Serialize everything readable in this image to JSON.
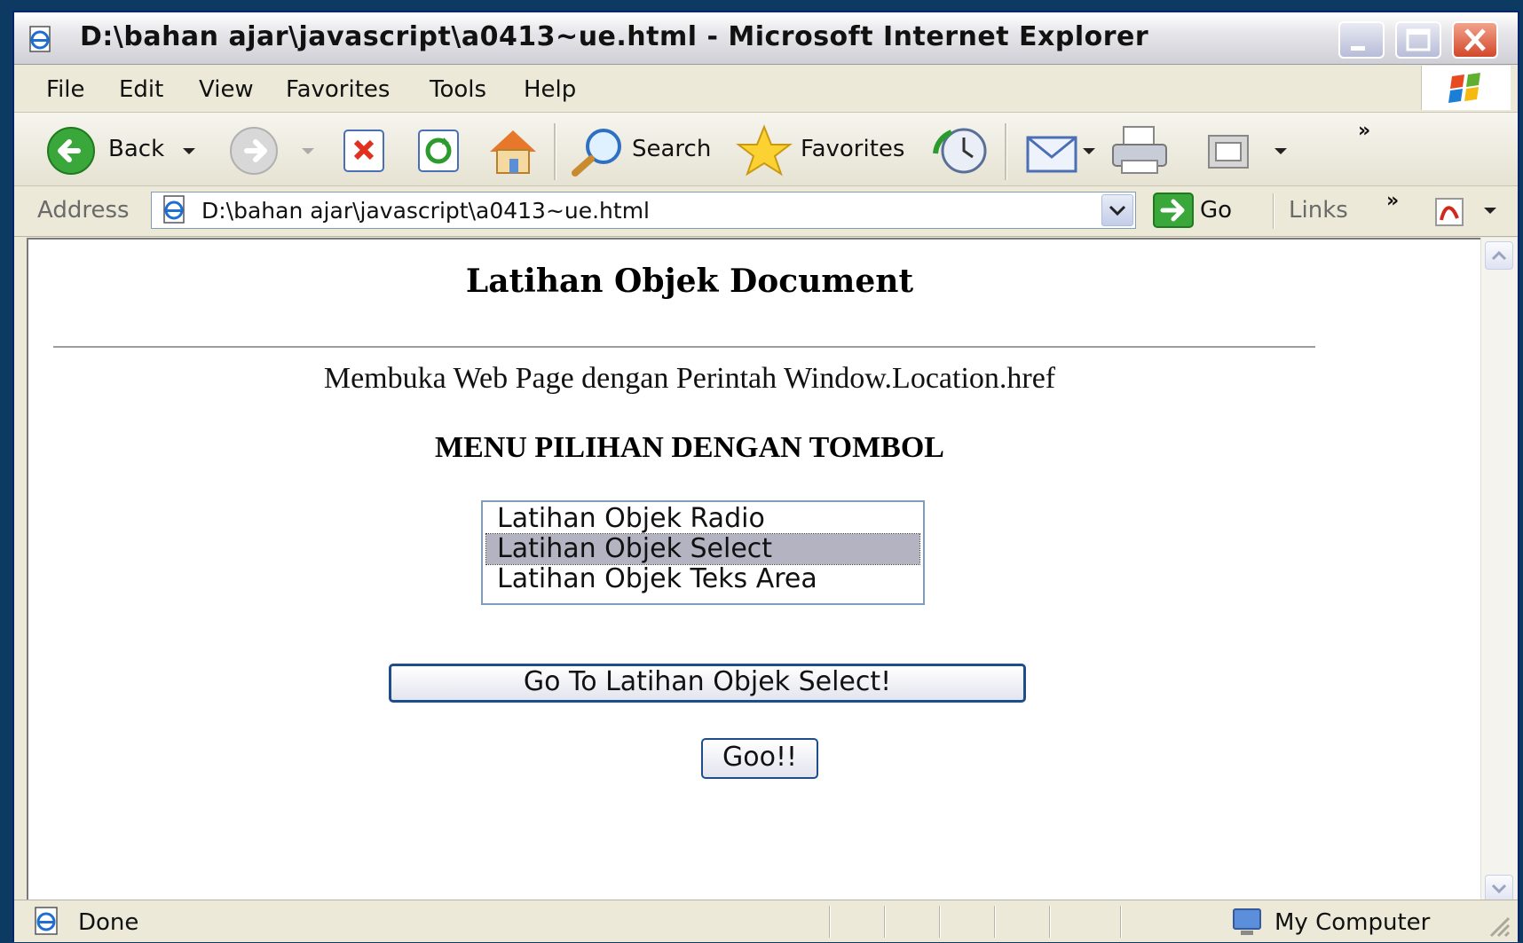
{
  "window": {
    "title": "D:\\bahan ajar\\javascript\\a0413~ue.html - Microsoft Internet Explorer"
  },
  "menubar": {
    "items": [
      "File",
      "Edit",
      "View",
      "Favorites",
      "Tools",
      "Help"
    ]
  },
  "toolbar": {
    "back_label": "Back",
    "search_label": "Search",
    "favorites_label": "Favorites"
  },
  "address": {
    "label": "Address",
    "url": "D:\\bahan ajar\\javascript\\a0413~ue.html",
    "go_label": "Go",
    "links_label": "Links"
  },
  "page": {
    "title": "Latihan Objek Document",
    "subtitle": "Membuka Web Page dengan Perintah Window.Location.href",
    "menu_heading": "MENU PILIHAN DENGAN TOMBOL",
    "listbox": {
      "options": [
        "Latihan Objek Radio",
        "Latihan Objek Select",
        "Latihan Objek Teks Area"
      ],
      "selected_index": 1
    },
    "go_to_button": "Go To Latihan Objek Select!",
    "goo_button": "Goo!!"
  },
  "statusbar": {
    "status": "Done",
    "zone": "My Computer"
  },
  "colors": {
    "titlebar_text": "#111111",
    "selection": "#b3b3c2",
    "button_border": "#1d4e89"
  }
}
